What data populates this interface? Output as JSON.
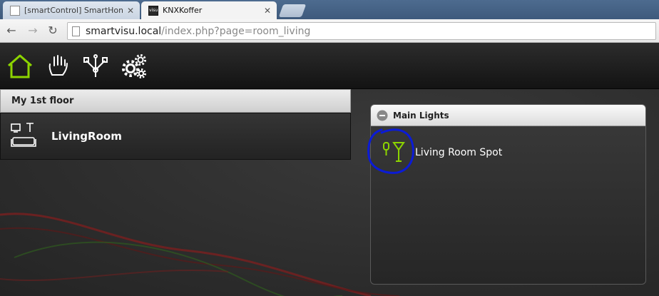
{
  "browser": {
    "tabs": [
      {
        "title": "[smartControl] SmartHom",
        "active": false
      },
      {
        "title": "KNXKoffer",
        "active": true
      }
    ],
    "url_host": "smartvisu.local",
    "url_path": "/index.php?page=room_living"
  },
  "nav": {
    "icons": [
      "home-icon",
      "hand-icon",
      "network-icon",
      "gears-icon"
    ],
    "accent_color": "#8cd400"
  },
  "floor": {
    "title": "My 1st floor"
  },
  "rooms": [
    {
      "label": "LivingRoom",
      "icon": "livingroom-icon"
    }
  ],
  "widget": {
    "title": "Main Lights",
    "items": [
      {
        "label": "Living Room Spot",
        "icon": "spotlight-icon",
        "highlight_color": "#0b1bd6"
      }
    ]
  }
}
